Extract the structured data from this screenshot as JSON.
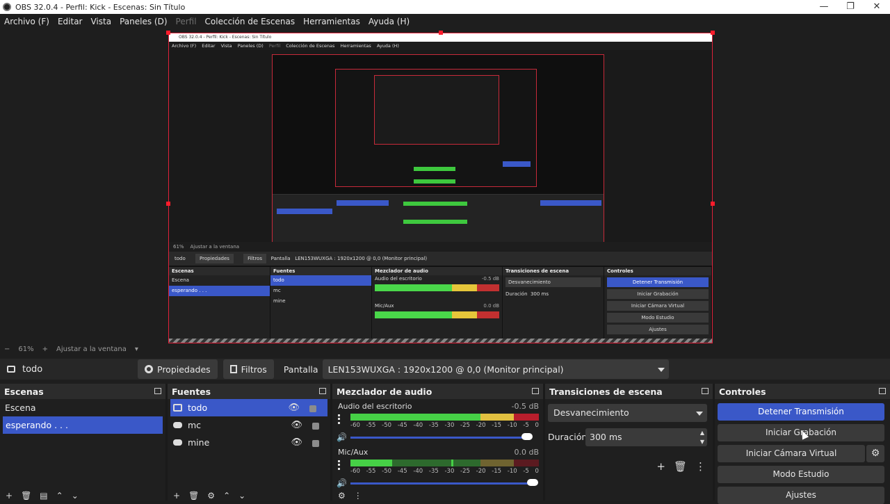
{
  "window": {
    "title": "OBS 32.0.4 - Perfil: Kick - Escenas: Sin Título",
    "controls": [
      "—",
      "❐",
      "✕"
    ]
  },
  "menu": {
    "items": [
      {
        "label": "Archivo (F)",
        "disabled": false
      },
      {
        "label": "Editar",
        "disabled": false
      },
      {
        "label": "Vista",
        "disabled": false
      },
      {
        "label": "Paneles (D)",
        "disabled": false
      },
      {
        "label": "Perfil",
        "disabled": true
      },
      {
        "label": "Colección de Escenas",
        "disabled": false
      },
      {
        "label": "Herramientas",
        "disabled": false
      },
      {
        "label": "Ayuda (H)",
        "disabled": false
      }
    ]
  },
  "preview_inner": {
    "title": "OBS 32.0.4 - Perfil: Kick - Escenas: Sin Título",
    "menu": [
      "Archivo (F)",
      "Editar",
      "Vista",
      "Paneles (D)",
      "Perfil",
      "Colección de Escenas",
      "Herramientas",
      "Ayuda (H)"
    ],
    "zoom": "61%",
    "fit": "Ajustar a la ventana",
    "source": "todo",
    "props": "Propiedades",
    "filters": "Filtros",
    "pantalla": "Pantalla",
    "monitor": "LEN153WUXGA : 1920x1200 @ 0,0 (Monitor principal)",
    "docks": {
      "escenas": "Escenas",
      "fuentes": "Fuentes",
      "mezclador": "Mezclador de audio",
      "transiciones": "Transiciones de escena",
      "controles": "Controles",
      "scene_items": [
        "Escena",
        "esperando . . ."
      ],
      "source_items": [
        "todo",
        "mc",
        "mine"
      ],
      "audio1": "Audio del escritorio",
      "audio1_db": "-0.5 dB",
      "audio2": "Mic/Aux",
      "audio2_db": "0.0 dB",
      "trans": "Desvanecimiento",
      "dur_label": "Duración",
      "dur": "300 ms",
      "ctrl": [
        "Detener Transmisión",
        "Iniciar Grabación",
        "Iniciar Cámara Virtual",
        "Modo Estudio",
        "Ajustes"
      ]
    }
  },
  "zoombar": {
    "minus": "−",
    "zoom": "61%",
    "plus": "+",
    "fit": "Ajustar a la ventana"
  },
  "sourcebar": {
    "source_name": "todo",
    "properties": "Propiedades",
    "filters": "Filtros",
    "pantalla_label": "Pantalla",
    "monitor": "LEN153WUXGA : 1920x1200 @ 0,0 (Monitor principal)"
  },
  "scenes": {
    "title": "Escenas",
    "items": [
      {
        "label": "Escena",
        "selected": false
      },
      {
        "label": "esperando . . .",
        "selected": true
      }
    ]
  },
  "sources": {
    "title": "Fuentes",
    "items": [
      {
        "label": "todo",
        "icon": "monitor-icon",
        "selected": true
      },
      {
        "label": "mc",
        "icon": "gamepad-icon",
        "selected": false
      },
      {
        "label": "mine",
        "icon": "gamepad-icon",
        "selected": false
      }
    ]
  },
  "mixer": {
    "title": "Mezclador de audio",
    "ticks": [
      "-60",
      "-55",
      "-50",
      "-45",
      "-40",
      "-35",
      "-30",
      "-25",
      "-20",
      "-15",
      "-10",
      "-5",
      "0"
    ],
    "channels": [
      {
        "name": "Audio del escritorio",
        "db": "-0.5 dB",
        "level": 0.95
      },
      {
        "name": "Mic/Aux",
        "db": "0.0 dB",
        "level": 1.0
      }
    ]
  },
  "transitions": {
    "title": "Transiciones de escena",
    "selected": "Desvanecimiento",
    "duration_label": "Duración",
    "duration": "300 ms"
  },
  "controls": {
    "title": "Controles",
    "stop_stream": "Detener Transmisión",
    "start_record": "Iniciar Grabación",
    "start_vcam": "Iniciar Cámara Virtual",
    "studio_mode": "Modo Estudio",
    "settings": "Ajustes"
  },
  "colors": {
    "accent": "#3a58c8",
    "selection_border": "#e0213a",
    "meter_green": "#46d046",
    "meter_yellow": "#e2c040",
    "meter_red": "#b81e2c"
  }
}
